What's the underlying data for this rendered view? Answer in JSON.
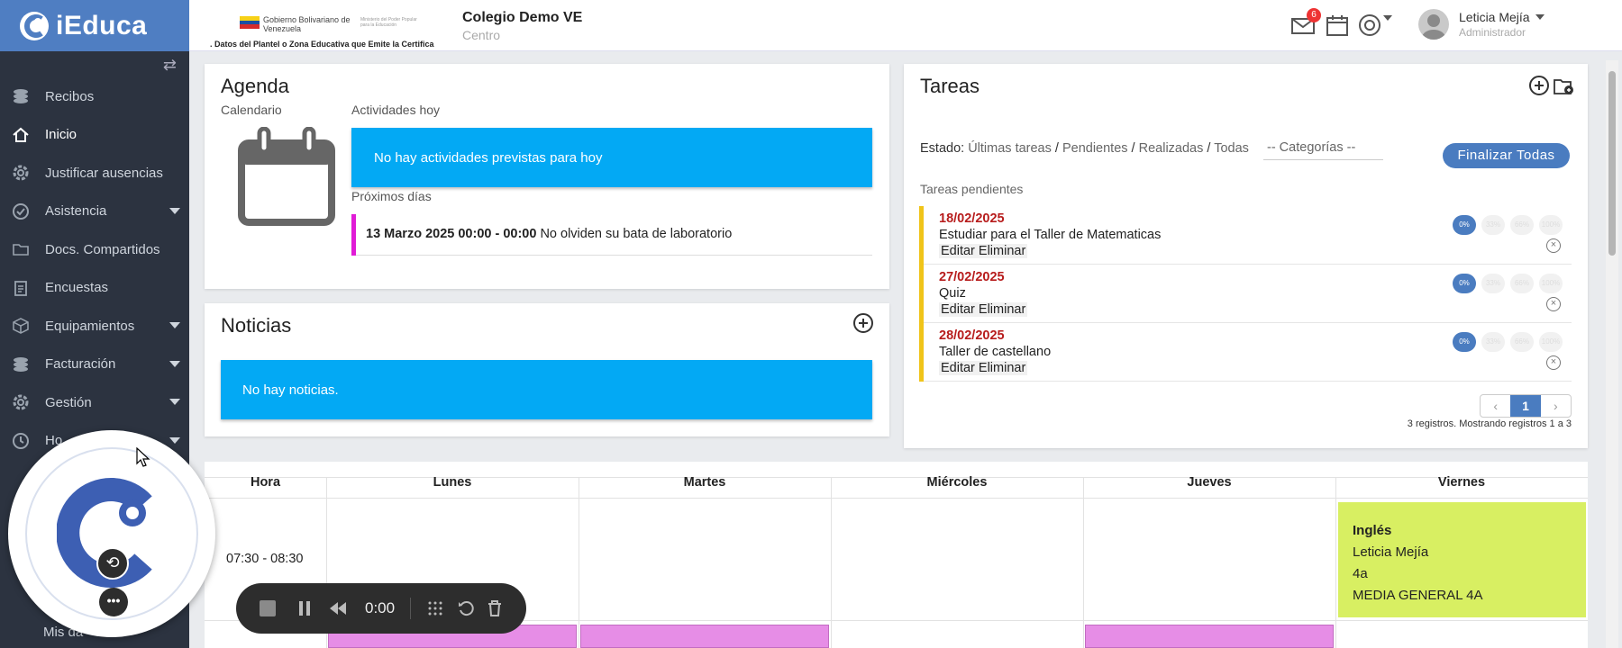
{
  "app": {
    "brand": "iEduca",
    "accent": "#4f7ec2",
    "sidebar_bg": "#2c3340"
  },
  "header": {
    "gov_line1": "Gobierno Bolivariano de Venezuela",
    "gov_line2": "Ministerio del Poder Popular para la Educación",
    "gov_subtitle": ". Datos del Plantel o Zona Educativa que Emite la Certifica",
    "school_name": "Colegio Demo VE",
    "school_subtitle": "Centro",
    "messages_badge": "6",
    "user_name": "Leticia Mejía",
    "user_role": "Administrador"
  },
  "sidebar": {
    "items": [
      {
        "label": "Recibos",
        "icon": "coins-icon"
      },
      {
        "label": "Inicio",
        "icon": "home-icon"
      },
      {
        "label": "Justificar ausencias",
        "icon": "gear-icon"
      },
      {
        "label": "Asistencia",
        "icon": "check-circle-icon"
      },
      {
        "label": "Docs. Compartidos",
        "icon": "folder-icon"
      },
      {
        "label": "Encuestas",
        "icon": "clipboard-icon"
      },
      {
        "label": "Equipamientos",
        "icon": "box-icon"
      },
      {
        "label": "Facturación",
        "icon": "coins-icon"
      },
      {
        "label": "Gestión",
        "icon": "gear-icon"
      },
      {
        "label": "Ho",
        "icon": "clock-icon"
      }
    ],
    "partial_bottom": "Mis da"
  },
  "agenda": {
    "title": "Agenda",
    "calendar_label": "Calendario",
    "today_label": "Actividades hoy",
    "no_activities": "No hay actividades previstas para hoy",
    "next_days_label": "Próximos días",
    "event_date": "13 Marzo 2025 00:00 - 00:00",
    "event_text": "No olviden su bata de laboratorio"
  },
  "noticias": {
    "title": "Noticias",
    "empty": "No hay noticias."
  },
  "tareas": {
    "title": "Tareas",
    "estado_label": "Estado:",
    "filters": [
      "Últimas tareas",
      "Pendientes",
      "Realizadas",
      "Todas"
    ],
    "category_select": "-- Categorías --",
    "finalize_button": "Finalizar Todas",
    "pending_label": "Tareas pendientes",
    "pct_labels": [
      "0%",
      "33%",
      "66%",
      "100%"
    ],
    "actions": "Editar Eliminar",
    "items": [
      {
        "date": "18/02/2025",
        "title": "Estudiar para el Taller de Matematicas"
      },
      {
        "date": "27/02/2025",
        "title": "Quiz"
      },
      {
        "date": "28/02/2025",
        "title": "Taller de castellano"
      }
    ],
    "page": "1",
    "records": "3 registros. Mostrando registros 1 a 3"
  },
  "schedule": {
    "headers": [
      "Hora",
      "Lunes",
      "Martes",
      "Miércoles",
      "Jueves",
      "Viernes"
    ],
    "time_slot": "07:30 - 08:30",
    "friday_class": {
      "subject": "Inglés",
      "teacher": "Leticia Mejía",
      "group": "4a",
      "level": "MEDIA GENERAL 4A"
    }
  },
  "recorder": {
    "time": "0:00"
  }
}
